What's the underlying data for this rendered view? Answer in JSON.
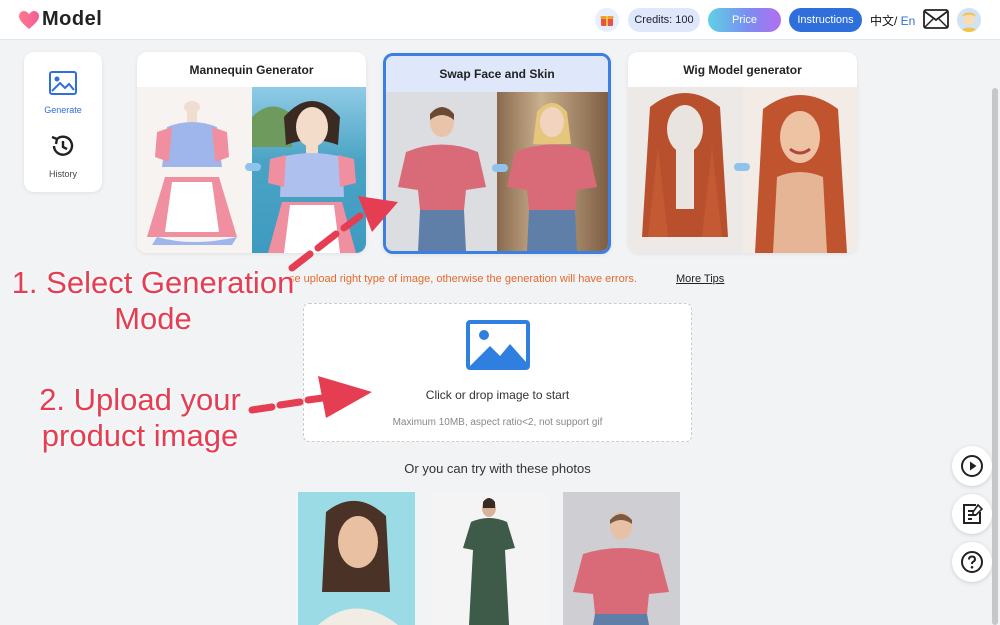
{
  "header": {
    "logo_text": "Model",
    "credits_label": "Credits: 100",
    "price_label": "Price",
    "instructions_label": "Instructions",
    "lang_zh": "中文/",
    "lang_en": " En"
  },
  "sidenav": {
    "items": [
      {
        "label": "Generate",
        "icon": "image-icon",
        "active": true
      },
      {
        "label": "History",
        "icon": "history-icon",
        "active": false
      }
    ]
  },
  "modes": [
    {
      "title": "Mannequin Generator",
      "selected": false
    },
    {
      "title": "Swap Face and Skin",
      "selected": true
    },
    {
      "title": "Wig Model generator",
      "selected": false
    }
  ],
  "tips": {
    "text": "se upload right type of image, otherwise the generation will have errors.",
    "more_link": "More Tips"
  },
  "upload": {
    "main_text": "Click or drop image to start",
    "sub_text": "Maximum 10MB, aspect ratio<2, not support gif"
  },
  "samples": {
    "label": "Or you can try with these photos"
  },
  "annotations": {
    "step1_line1": "1. Select Generation",
    "step1_line2": "Mode",
    "step2_line1": "2. Upload your",
    "step2_line2": "product image"
  },
  "colors": {
    "accent": "#2f6fdc",
    "annotation": "#e53e52",
    "tip": "#e56a2e"
  }
}
